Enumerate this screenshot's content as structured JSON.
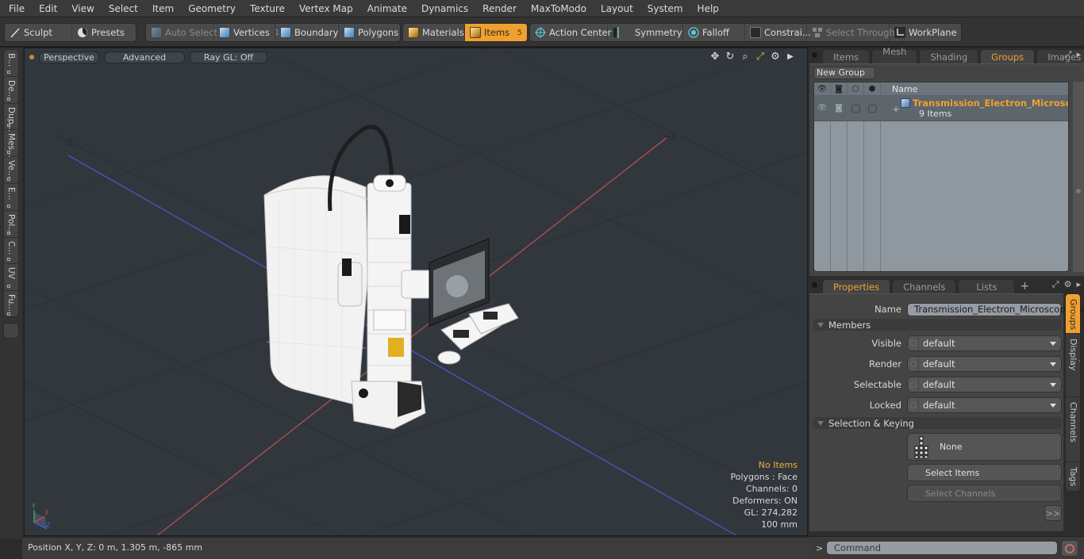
{
  "menu": [
    "File",
    "Edit",
    "View",
    "Select",
    "Item",
    "Geometry",
    "Texture",
    "Vertex Map",
    "Animate",
    "Dynamics",
    "Render",
    "MaxToModo",
    "Layout",
    "System",
    "Help"
  ],
  "toolbar": {
    "sculpt": "Sculpt",
    "presets": "Presets",
    "auto_select": "Auto Select",
    "vertices": "Vertices",
    "vertices_count": "1",
    "boundary": "Boundary",
    "polygons": "Polygons",
    "materials": "Materials",
    "items": "Items",
    "items_count": "5",
    "action_center": "Action Center",
    "symmetry": "Symmetry",
    "falloff": "Falloff",
    "constraints": "Constrai...",
    "select_through": "Select Through",
    "workplane": "WorkPlane"
  },
  "left_tabs": [
    "B...",
    "De...",
    "Dup...",
    "Mes...",
    "Ve...",
    "E...",
    "Pol...",
    "C...",
    "UV",
    "Fu..."
  ],
  "viewport": {
    "view_mode": "Perspective",
    "shading": "Advanced",
    "raygl": "Ray GL: Off",
    "axis_labels": {
      "neg_z": "-Z",
      "pos_x": "+X"
    },
    "info": {
      "selection": "No Items",
      "polygons": "Polygons : Face",
      "channels": "Channels: 0",
      "deformers": "Deformers: ON",
      "gl": "GL: 274,282",
      "grid": "100 mm"
    }
  },
  "status": {
    "position": "Position X, Y, Z:   0 m, 1.305 m, -865 mm"
  },
  "groups_panel": {
    "tabs": [
      "Items",
      "Mesh ...",
      "Shading",
      "Groups",
      "Images"
    ],
    "active_tab": "Groups",
    "new_group": "New Group",
    "column_name": "Name",
    "rows": [
      {
        "name": "Transmission_Electron_Microsc ...",
        "sub": "9 Items"
      }
    ]
  },
  "properties_panel": {
    "tabs": [
      "Properties",
      "Channels",
      "Lists"
    ],
    "active_tab": "Properties",
    "name_label": "Name",
    "name_value": "Transmission_Electron_Microscope_Wi",
    "members_label": "Members",
    "fields": [
      {
        "label": "Visible",
        "value": "default"
      },
      {
        "label": "Render",
        "value": "default"
      },
      {
        "label": "Selectable",
        "value": "default"
      },
      {
        "label": "Locked",
        "value": "default"
      }
    ],
    "selection_keying_label": "Selection & Keying",
    "hierarchy_value": "None",
    "select_items": "Select Items",
    "select_channels": "Select Channels",
    "more": ">>",
    "side_tabs": [
      "Groups",
      "Group Display",
      "User Channels",
      "Tags"
    ]
  },
  "command": {
    "prompt": ">",
    "placeholder": "Command"
  },
  "colors": {
    "accent": "#f0a030",
    "viewport_bg": "#31373d",
    "x_axis": "#c05050",
    "z_axis": "#4a5ad0"
  }
}
